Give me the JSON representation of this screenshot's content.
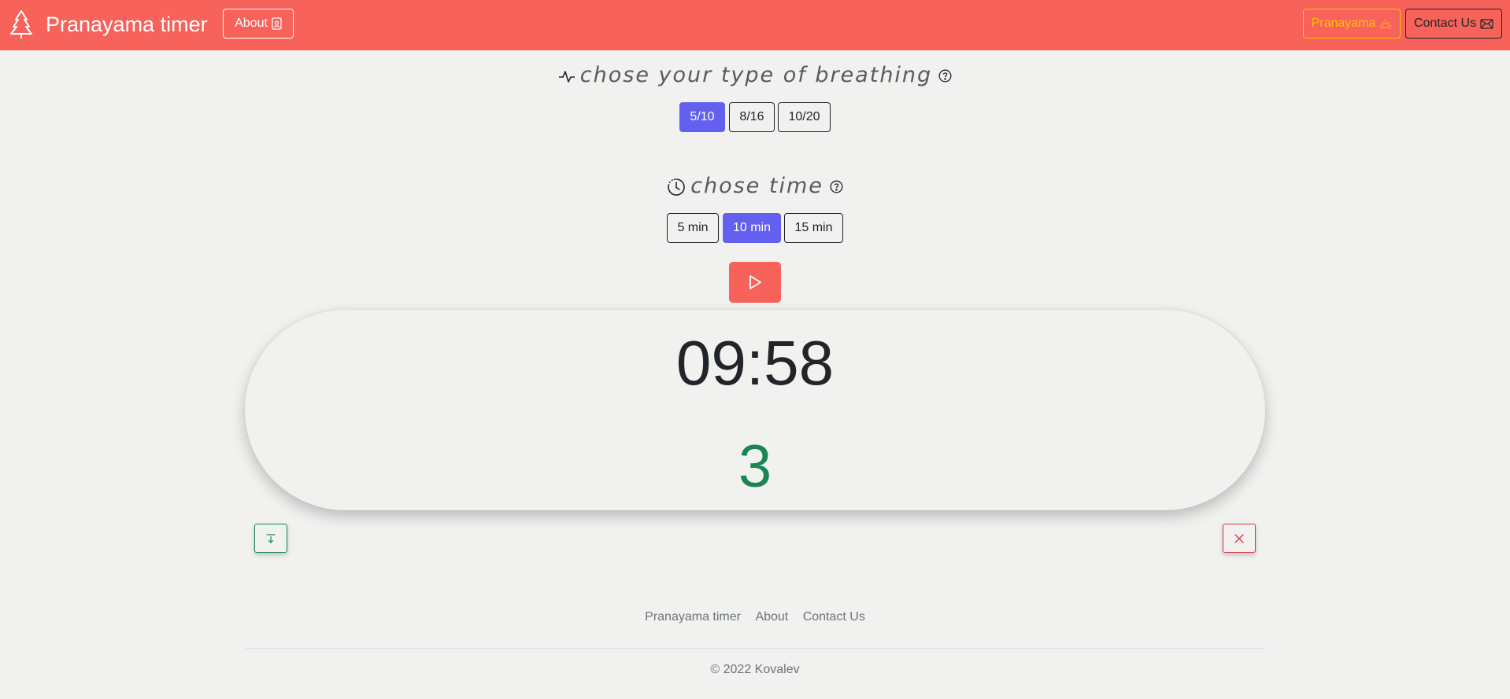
{
  "navbar": {
    "brand_title": "Pranayama timer",
    "about_label": "About",
    "pranayama_label": "Pranayama",
    "contact_label": "Contact Us",
    "background_color": "#f7625a"
  },
  "breathing": {
    "heading": "chose your type of breathing",
    "options": [
      "5/10",
      "8/16",
      "10/20"
    ],
    "selected": "5/10"
  },
  "time": {
    "heading": "chose time",
    "options": [
      "5 min",
      "10 min",
      "15 min"
    ],
    "selected": "10 min"
  },
  "timer": {
    "display": "09:58",
    "breath_count": "3"
  },
  "footer": {
    "links": [
      "Pranayama timer",
      "About",
      "Contact Us"
    ],
    "copyright": "© 2022 Kovalev"
  },
  "colors": {
    "accent": "#6360f0",
    "brand": "#f7625a",
    "success": "#198754",
    "danger": "#dc3545",
    "warning": "#ffc107"
  },
  "icons": {
    "brand": "tree-icon",
    "about": "person-badge-icon",
    "pranayama": "sunrise-icon",
    "contact": "envelope-icon",
    "breathing": "activity-icon",
    "time": "clock-history-icon",
    "help": "question-circle-icon",
    "play": "play-icon",
    "down": "arrow-bar-down-icon",
    "close": "x-icon"
  }
}
